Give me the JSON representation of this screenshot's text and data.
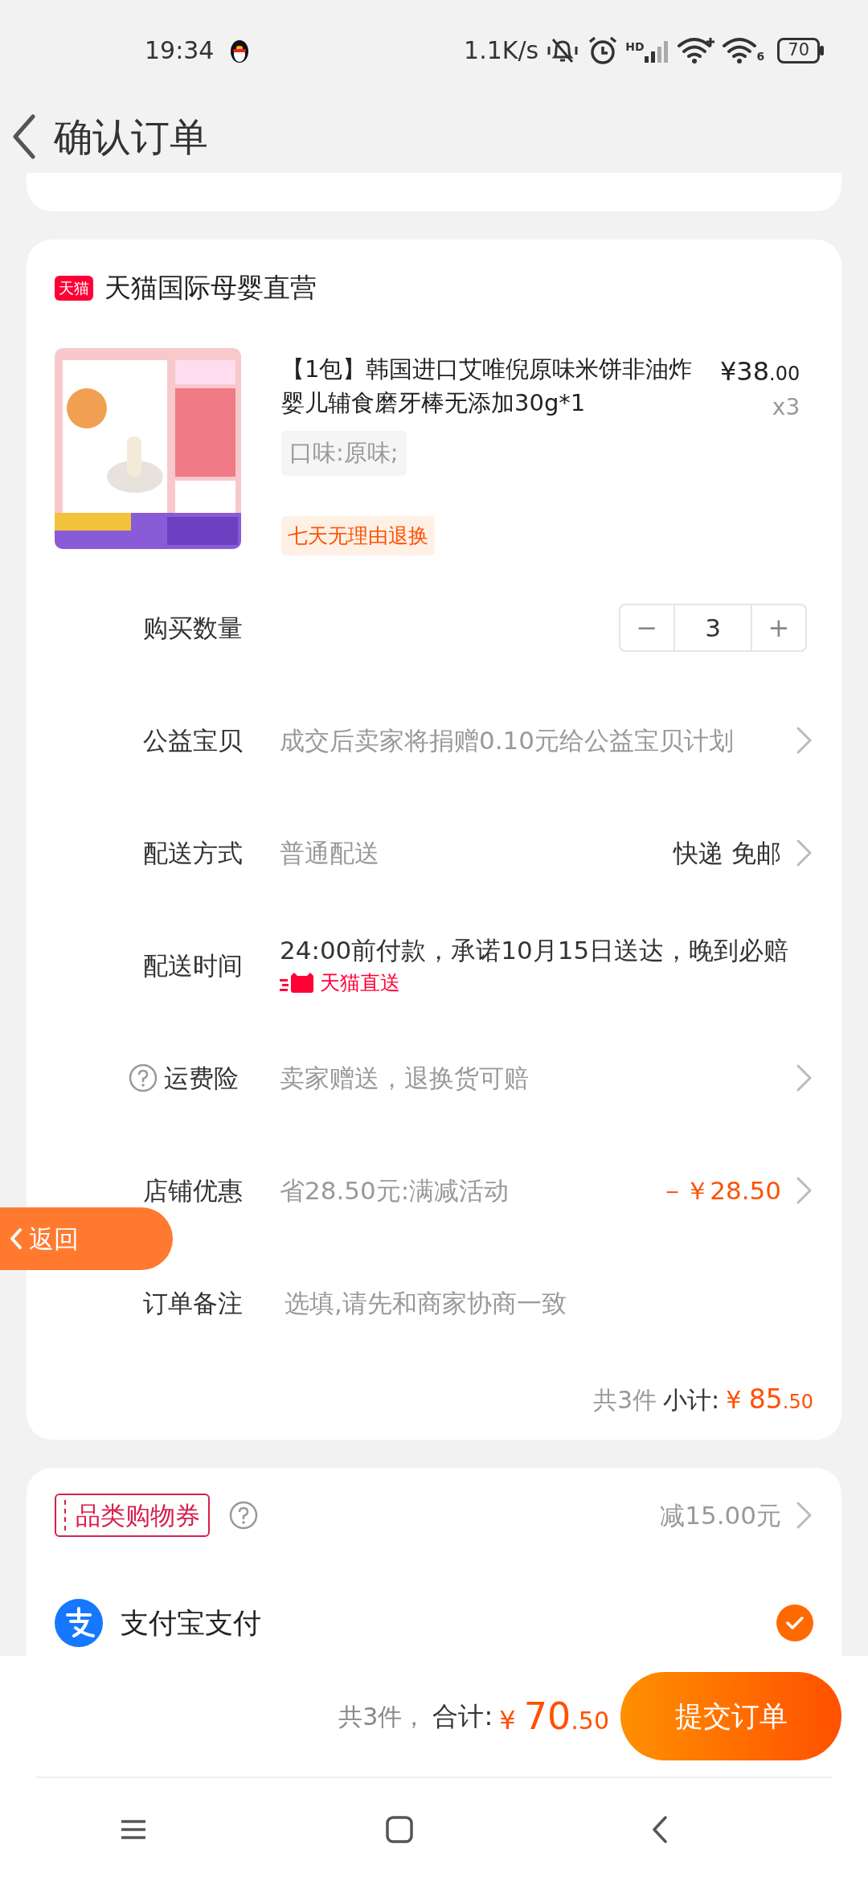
{
  "status_bar": {
    "time": "19:34",
    "net_speed": "1.1K/s",
    "signal_label": "HD",
    "wifi_badge": "6",
    "battery": "70"
  },
  "header": {
    "title": "确认订单"
  },
  "shop": {
    "logo_text": "天猫",
    "name": "天猫国际母婴直营"
  },
  "product": {
    "title": "【1包】韩国进口艾唯倪原味米饼非油炸婴儿辅食磨牙棒无添加30g*1",
    "price_symbol": "¥",
    "price_int": "38",
    "price_dec": ".00",
    "quantity": "x3",
    "spec": "口味:原味;",
    "service_tag": "七天无理由退换"
  },
  "rows": [
    {
      "kind": "stepper",
      "label": "购买数量",
      "help": false,
      "minus": "−",
      "value": "3",
      "plus": "+"
    },
    {
      "kind": "link",
      "label": "公益宝贝",
      "help": false,
      "text": "成交后卖家将捐赠0.10元给公益宝贝计划"
    },
    {
      "kind": "link",
      "label": "配送方式",
      "help": false,
      "text": "普通配送",
      "extra": "快递 免邮"
    },
    {
      "kind": "delivery",
      "label": "配送时间",
      "help": false,
      "text": "24:00前付款，承诺10月15日送达，晚到必赔",
      "badge": "天猫直送"
    },
    {
      "kind": "link",
      "label": "运费险",
      "help": true,
      "text": "卖家赠送，退换货可赔"
    },
    {
      "kind": "discount",
      "label": "店铺优惠",
      "help": false,
      "text": "省28.50元:满减活动",
      "extra": "－￥28.50"
    },
    {
      "kind": "input",
      "label": "订单备注",
      "help": false,
      "placeholder": "选填,请先和商家协商一致"
    }
  ],
  "subtotal": {
    "count": "共3件",
    "label": "小计:",
    "symbol": "¥",
    "int": "85",
    "dec": ".50"
  },
  "floating_back": {
    "label": "返回"
  },
  "coupon": {
    "label": "品类购物券",
    "value": "减15.00元"
  },
  "payment": {
    "name": "支付宝支付",
    "selected": true
  },
  "footer": {
    "count": "共3件，",
    "label": "合计:",
    "symbol": "¥",
    "int": "70",
    "dec": ".50",
    "button": "提交订单"
  }
}
